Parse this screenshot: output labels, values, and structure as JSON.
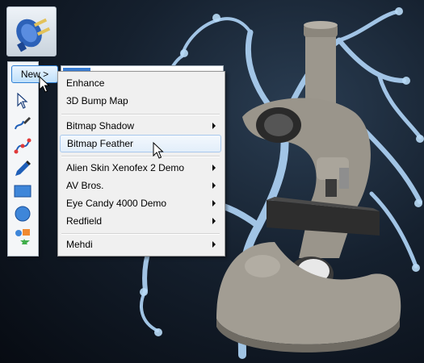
{
  "toolbar": {
    "new_label": "New >"
  },
  "menu": {
    "items": [
      {
        "label": "Enhance",
        "submenu": false
      },
      {
        "label": "3D Bump Map",
        "submenu": false
      },
      {
        "label": "Bitmap Shadow",
        "submenu": true
      },
      {
        "label": "Bitmap Feather",
        "submenu": false,
        "highlighted": true
      },
      {
        "label": "Alien Skin Xenofex 2 Demo",
        "submenu": true
      },
      {
        "label": "AV Bros.",
        "submenu": true
      },
      {
        "label": "Eye Candy 4000 Demo",
        "submenu": true
      },
      {
        "label": "Redfield",
        "submenu": true
      },
      {
        "label": "Mehdi",
        "submenu": true
      }
    ]
  },
  "palette": {
    "tools": [
      "pointer-tool-icon",
      "freehand-pen-icon",
      "bezier-node-icon",
      "pen-draw-icon",
      "rectangle-icon",
      "ellipse-icon",
      "shapes-icon"
    ]
  },
  "colors": {
    "menu_bg": "#f0f0f0",
    "highlight_border": "#a8c8ec",
    "button_border": "#2f7fd4",
    "coral": "#9fc3e6",
    "microscope": "#9a958b"
  }
}
